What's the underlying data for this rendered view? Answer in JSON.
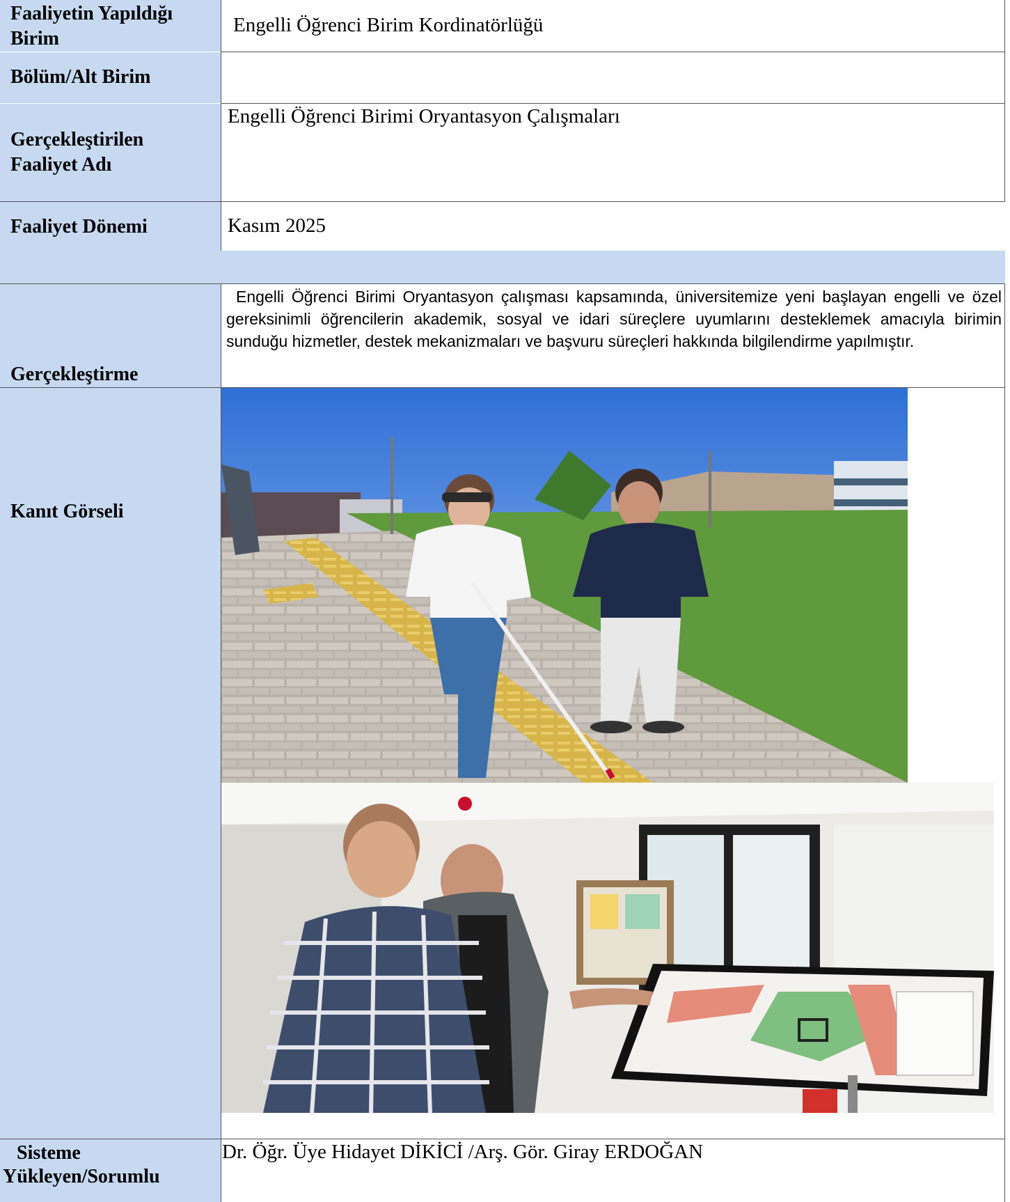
{
  "rows": {
    "unit": {
      "label": "Faaliyetin Yapıldığı Birim",
      "value": "Engelli Öğrenci Birim Kordinatörlüğü"
    },
    "department": {
      "label": "Bölüm/Alt Birim",
      "value": ""
    },
    "activity_name": {
      "label": "Gerçekleştirilen Faaliyet Adı",
      "value": "Engelli Öğrenci Birimi Oryantasyon Çalışmaları"
    },
    "period": {
      "label": "Faaliyet Dönemi",
      "value": "Kasım  2025"
    },
    "implementation": {
      "label": "Gerçekleştirme",
      "value": "Engelli Öğrenci Birimi Oryantasyon çalışması kapsamında, üniversitemize yeni başlayan engelli ve özel gereksinimli öğrencilerin akademik, sosyal ve idari süreçlere uyumlarını desteklemek amacıyla birimin sunduğu hizmetler, destek mekanizmaları ve başvuru süreçleri hakkında bilgilendirme yapılmıştır."
    },
    "evidence": {
      "label": "Kanıt Görseli"
    },
    "responsible": {
      "label_line1": "Sisteme",
      "label_line2": "Yükleyen/Sorumlu",
      "value": "Dr. Öğr. Üye Hidayet DİKİCİ /Arş. Gör. Giray ERDOĞAN"
    }
  },
  "colors": {
    "label_bg": "#c6d9f1",
    "border": "#555555"
  }
}
